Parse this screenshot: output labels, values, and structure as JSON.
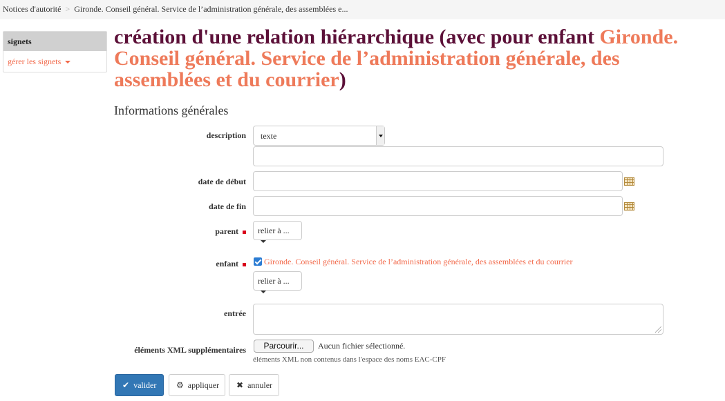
{
  "breadcrumb": {
    "root": "Notices d'autorité",
    "separator": ">",
    "current": "Gironde. Conseil général. Service de l’administration générale, des assemblées e..."
  },
  "sidebar": {
    "title": "signets",
    "manage_label": "gérer les signets"
  },
  "page": {
    "title_prefix": "création d'une relation hiérarchique (avec pour enfant ",
    "title_entity": "Gironde. Conseil général. Service de l’administration générale, des assemblées et du courrier",
    "title_suffix": ")",
    "section": "Informations générales"
  },
  "form": {
    "description_label": "description",
    "description_select_value": "texte",
    "description_value": "",
    "start_date_label": "date de début",
    "start_date_value": "",
    "end_date_label": "date de fin",
    "end_date_value": "",
    "parent_label": "parent",
    "parent_dropdown": "relier à ...",
    "child_label": "enfant",
    "child_checkbox_text": "Gironde. Conseil général. Service de l’administration générale, des assemblées et du courrier",
    "child_checked": true,
    "child_dropdown": "relier à ...",
    "entry_label": "entrée",
    "entry_value": "",
    "xml_label": "éléments XML supplémentaires",
    "file_button": "Parcourir...",
    "file_status": "Aucun fichier sélectionné.",
    "xml_help": "éléments XML non contenus dans l'espace des noms EAC-CPF"
  },
  "actions": {
    "validate": "valider",
    "apply": "appliquer",
    "cancel": "annuler"
  },
  "colors": {
    "title_dark": "#5c1038",
    "title_accent": "#ee7a5a",
    "link": "#f2694a",
    "primary": "#3277b5",
    "required": "#d9001b"
  },
  "icons": {
    "validate": "check-icon",
    "apply": "gear-icon",
    "cancel": "close-icon",
    "date_picker": "calendar-icon"
  }
}
